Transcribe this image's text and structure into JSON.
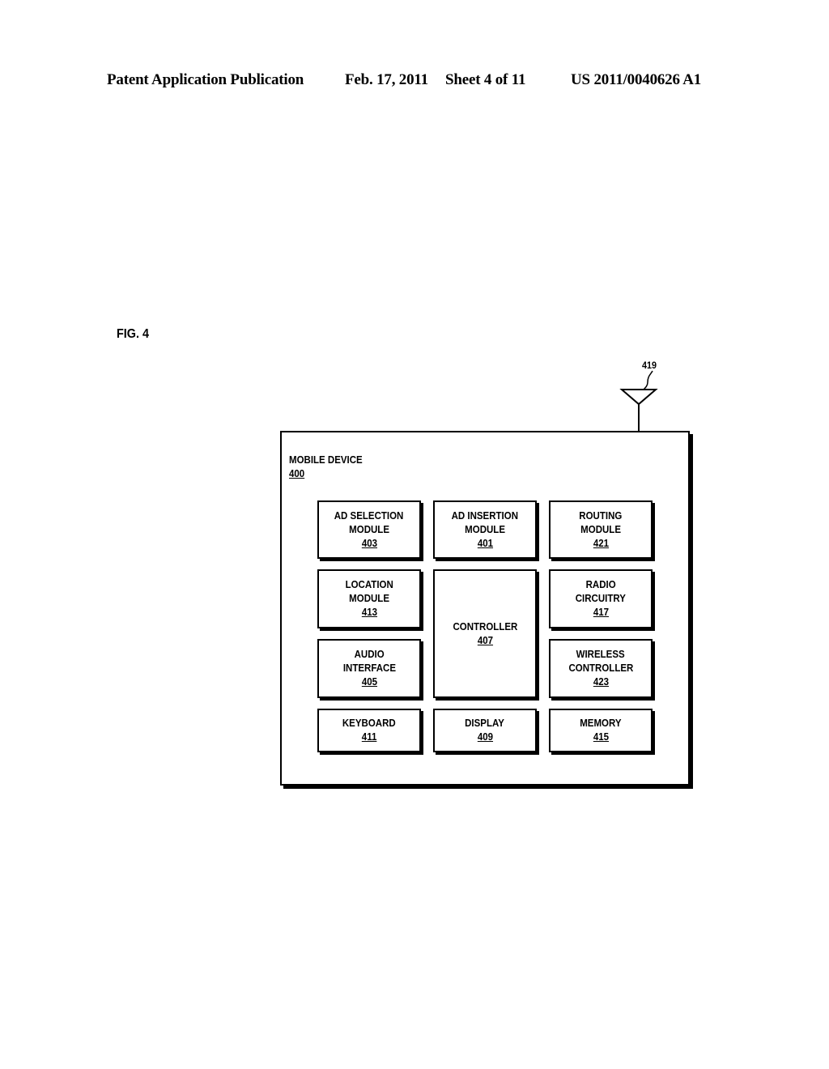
{
  "header": {
    "publication": "Patent Application Publication",
    "date": "Feb. 17, 2011",
    "sheet": "Sheet 4 of 11",
    "number": "US 2011/0040626 A1"
  },
  "figure": {
    "label": "FIG. 4",
    "antenna": {
      "ref": "419"
    },
    "device": {
      "name": "MOBILE DEVICE",
      "ref": "400"
    },
    "modules": [
      {
        "id": "ad-selection",
        "lines": [
          "AD SELECTION",
          "MODULE"
        ],
        "ref": "403"
      },
      {
        "id": "ad-insertion",
        "lines": [
          "AD INSERTION",
          "MODULE"
        ],
        "ref": "401"
      },
      {
        "id": "routing",
        "lines": [
          "ROUTING",
          "MODULE"
        ],
        "ref": "421"
      },
      {
        "id": "location",
        "lines": [
          "LOCATION",
          "MODULE"
        ],
        "ref": "413"
      },
      {
        "id": "controller",
        "lines": [
          "CONTROLLER"
        ],
        "ref": "407"
      },
      {
        "id": "radio",
        "lines": [
          "RADIO",
          "CIRCUITRY"
        ],
        "ref": "417"
      },
      {
        "id": "audio",
        "lines": [
          "AUDIO",
          "INTERFACE"
        ],
        "ref": "405"
      },
      {
        "id": "wireless",
        "lines": [
          "WIRELESS",
          "CONTROLLER"
        ],
        "ref": "423"
      },
      {
        "id": "keyboard",
        "lines": [
          "KEYBOARD"
        ],
        "ref": "411"
      },
      {
        "id": "display",
        "lines": [
          "DISPLAY"
        ],
        "ref": "409"
      },
      {
        "id": "memory",
        "lines": [
          "MEMORY"
        ],
        "ref": "415"
      }
    ]
  }
}
